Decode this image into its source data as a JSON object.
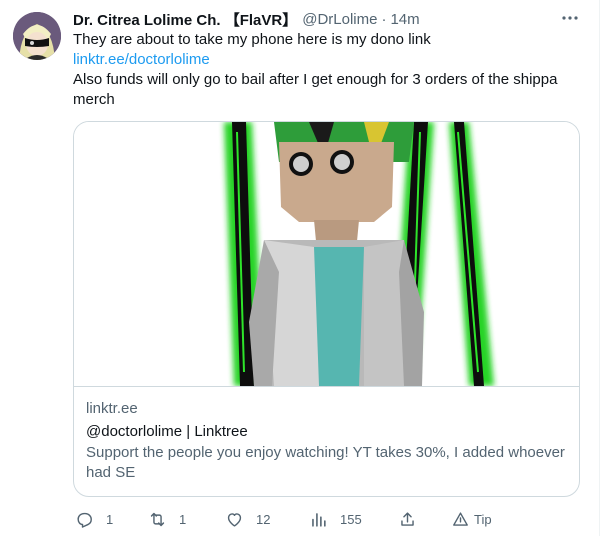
{
  "tweet": {
    "display_name": "Dr. Citrea Lolime Ch. 【FlaVR】",
    "handle": "@DrLolime",
    "separator": "·",
    "time": "14m",
    "line1": "They are about to take my phone here is my dono link",
    "link": "linktr.ee/doctorlolime",
    "line3": "Also funds will only go to bail after I get enough for 3 orders of the shippa merch"
  },
  "card": {
    "domain": "linktr.ee",
    "title": "@doctorlolime | Linktree",
    "description": "Support the people you enjoy watching! YT takes 30%, I added whoever had SE"
  },
  "actions": {
    "replies": "1",
    "retweets": "1",
    "likes": "12",
    "views": "155",
    "tip": "Tip"
  },
  "colors": {
    "link": "#1d9bf0",
    "muted": "#536471",
    "border": "#cfd9de",
    "glow": "#22c21a"
  }
}
